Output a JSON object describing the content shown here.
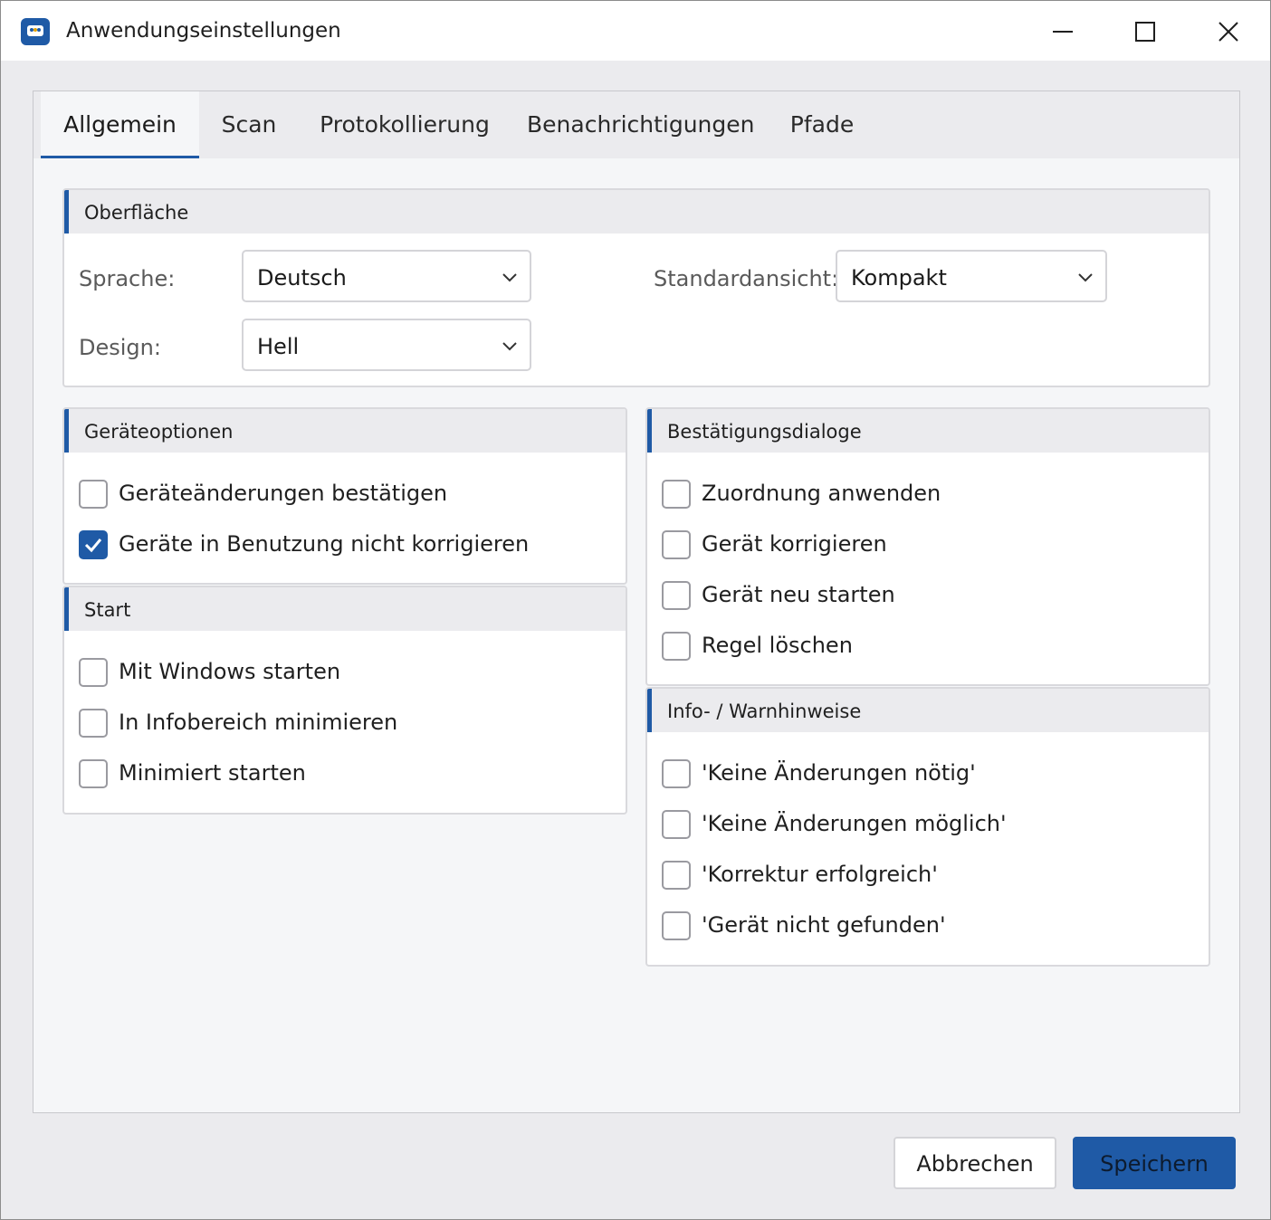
{
  "window": {
    "title": "Anwendungseinstellungen",
    "accent_color": "#1f5aa6",
    "controls": {
      "minimize_icon": "minimize-icon",
      "maximize_icon": "maximize-icon",
      "close_icon": "close-icon"
    }
  },
  "tabs": [
    {
      "label": "Allgemein",
      "active": true
    },
    {
      "label": "Scan",
      "active": false
    },
    {
      "label": "Protokollierung",
      "active": false
    },
    {
      "label": "Benachrichtigungen",
      "active": false
    },
    {
      "label": "Pfade",
      "active": false
    }
  ],
  "oberflaeche": {
    "title": "Oberfläche",
    "sprache": {
      "label": "Sprache:",
      "value": "Deutsch"
    },
    "design": {
      "label": "Design:",
      "value": "Hell"
    },
    "standardansicht": {
      "label": "Standardansicht:",
      "value": "Kompakt"
    }
  },
  "geraeteoptionen": {
    "title": "Geräteoptionen",
    "items": [
      {
        "label": "Geräteänderungen bestätigen",
        "checked": false
      },
      {
        "label": "Geräte in Benutzung nicht korrigieren",
        "checked": true
      }
    ]
  },
  "start": {
    "title": "Start",
    "items": [
      {
        "label": "Mit Windows starten",
        "checked": false
      },
      {
        "label": "In Infobereich minimieren",
        "checked": false
      },
      {
        "label": "Minimiert starten",
        "checked": false
      }
    ]
  },
  "bestaetigungsdialoge": {
    "title": "Bestätigungsdialoge",
    "items": [
      {
        "label": "Zuordnung anwenden",
        "checked": false
      },
      {
        "label": "Gerät korrigieren",
        "checked": false
      },
      {
        "label": "Gerät neu starten",
        "checked": false
      },
      {
        "label": "Regel löschen",
        "checked": false
      }
    ]
  },
  "hinweise": {
    "title": "Info- / Warnhinweise",
    "items": [
      {
        "label": "'Keine Änderungen nötig'",
        "checked": false
      },
      {
        "label": "'Keine Änderungen möglich'",
        "checked": false
      },
      {
        "label": "'Korrektur erfolgreich'",
        "checked": false
      },
      {
        "label": "'Gerät nicht gefunden'",
        "checked": false
      }
    ]
  },
  "buttons": {
    "cancel": "Abbrechen",
    "save": "Speichern"
  }
}
